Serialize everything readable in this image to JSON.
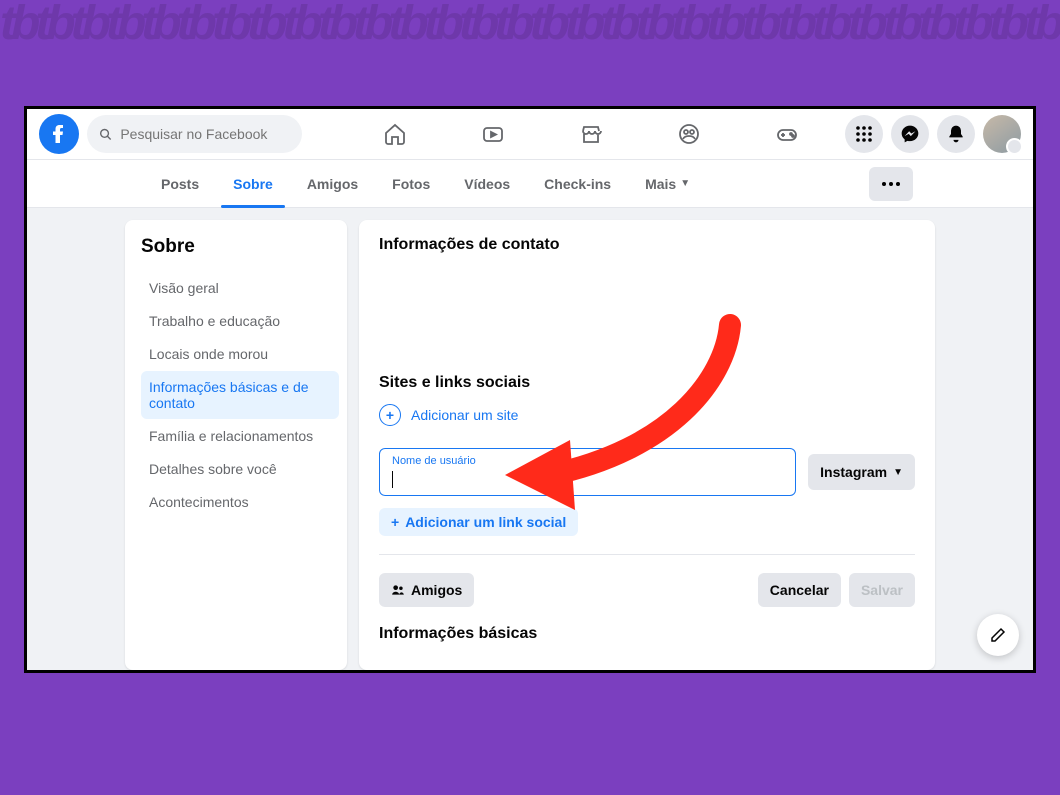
{
  "search": {
    "placeholder": "Pesquisar no Facebook"
  },
  "profileTabs": {
    "items": [
      {
        "label": "Posts"
      },
      {
        "label": "Sobre"
      },
      {
        "label": "Amigos"
      },
      {
        "label": "Fotos"
      },
      {
        "label": "Vídeos"
      },
      {
        "label": "Check-ins"
      },
      {
        "label": "Mais"
      }
    ],
    "activeIndex": 1
  },
  "sidebar": {
    "title": "Sobre",
    "items": [
      {
        "label": "Visão geral"
      },
      {
        "label": "Trabalho e educação"
      },
      {
        "label": "Locais onde morou"
      },
      {
        "label": "Informações básicas e de contato"
      },
      {
        "label": "Família e relacionamentos"
      },
      {
        "label": "Detalhes sobre você"
      },
      {
        "label": "Acontecimentos"
      }
    ],
    "activeIndex": 3
  },
  "main": {
    "contactHeader": "Informações de contato",
    "sitesHeader": "Sites e links sociais",
    "addSiteLabel": "Adicionar um site",
    "usernameLabel": "Nome de usuário",
    "usernameValue": "",
    "platformSelected": "Instagram",
    "addSocialLabel": "Adicionar um link social",
    "audienceLabel": "Amigos",
    "cancelLabel": "Cancelar",
    "saveLabel": "Salvar",
    "basicHeader": "Informações básicas"
  },
  "colors": {
    "accent": "#1877f2"
  }
}
